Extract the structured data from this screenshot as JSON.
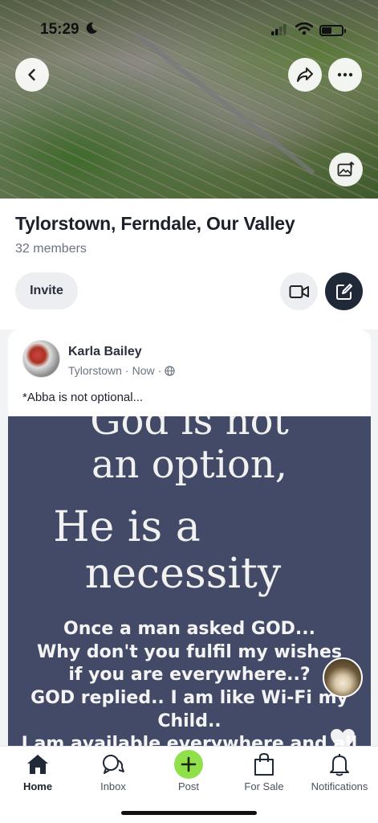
{
  "status_bar": {
    "time": "15:29"
  },
  "group": {
    "title": "Tylorstown, Ferndale, Our Valley",
    "members": "32 members",
    "invite_label": "Invite"
  },
  "post": {
    "author": "Karla Bailey",
    "location": "Tylorstown",
    "time": "Now",
    "caption": "*Abba is not optional...",
    "image_text": {
      "line1": "God is not",
      "line2": "an option,",
      "line3": "He is a",
      "line4": "necessity",
      "body": [
        "Once a man asked GOD...",
        "Why don't you  fulfil my wishes",
        "if you are everywhere..?",
        "GOD replied.. I am like Wi-Fi my",
        "Child..",
        "I am available everywhere and all"
      ]
    },
    "like_count": "0"
  },
  "tabs": [
    {
      "label": "Home",
      "icon": "home-icon"
    },
    {
      "label": "Inbox",
      "icon": "inbox-icon"
    },
    {
      "label": "Post",
      "icon": "plus-icon"
    },
    {
      "label": "For Sale",
      "icon": "bag-icon"
    },
    {
      "label": "Notifications",
      "icon": "bell-icon"
    }
  ],
  "colors": {
    "accent_green": "#8fe04a",
    "dark_button": "#1f2937",
    "quote_background": "#434a67"
  }
}
